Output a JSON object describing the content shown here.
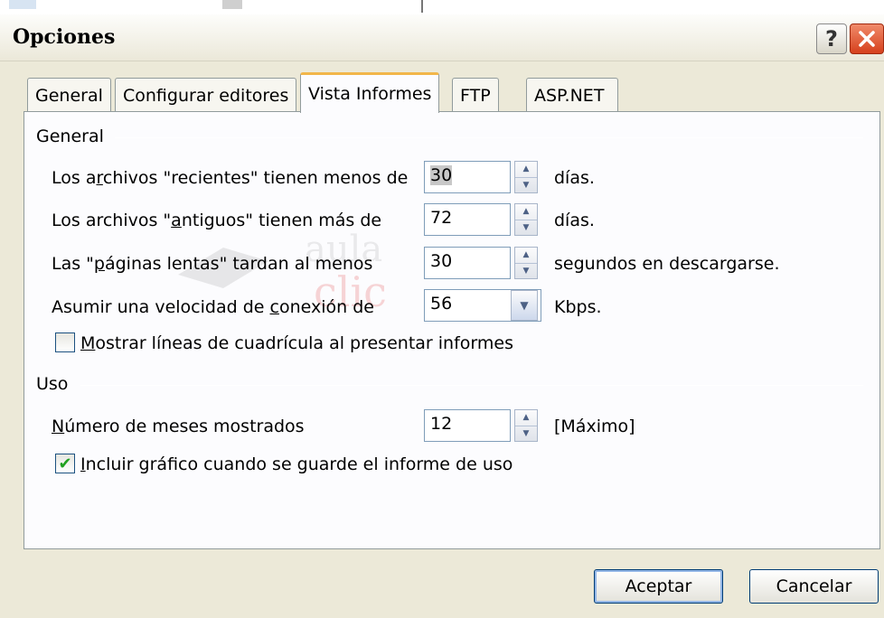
{
  "window": {
    "title": "Opciones"
  },
  "tabs": [
    {
      "label": "General"
    },
    {
      "label": "Configurar editores"
    },
    {
      "label": "Vista Informes"
    },
    {
      "label": "FTP"
    },
    {
      "label": "ASP.NET"
    }
  ],
  "general_group": {
    "label": "General",
    "recent_label_pre": "Los a",
    "recent_label_key": "r",
    "recent_label_post": "chivos \"recientes\" tienen menos de",
    "recent_value": "30",
    "recent_unit": "días.",
    "old_label_pre": "Los archivos \"",
    "old_label_key": "a",
    "old_label_post": "ntiguos\" tienen más de",
    "old_value": "72",
    "old_unit": "días.",
    "slow_label_pre": "Las \"",
    "slow_label_key": "p",
    "slow_label_post": "áginas lentas\" tardan al menos",
    "slow_value": "30",
    "slow_unit": "segundos en descargarse.",
    "speed_label_pre": "Asumir una velocidad de ",
    "speed_label_key": "c",
    "speed_label_post": "onexión de",
    "speed_value": "56",
    "speed_unit": "Kbps.",
    "gridlines_label_key": "M",
    "gridlines_label_post": "ostrar líneas de cuadrícula al presentar informes",
    "gridlines_checked": false
  },
  "uso_group": {
    "label": "Uso",
    "months_label_key": "N",
    "months_label_post": "úmero de meses mostrados",
    "months_value": "12",
    "months_unit": "[Máximo]",
    "include_label_key": "I",
    "include_label_post": "ncluir gráfico cuando se guarde el informe de uso",
    "include_checked": true
  },
  "buttons": {
    "ok": "Aceptar",
    "cancel": "Cancelar"
  },
  "icons": {
    "help": "question-mark-icon",
    "close": "close-icon",
    "spin": "spin-up-down-icon",
    "dropdown": "chevron-down-icon",
    "check": "checkmark-icon"
  }
}
